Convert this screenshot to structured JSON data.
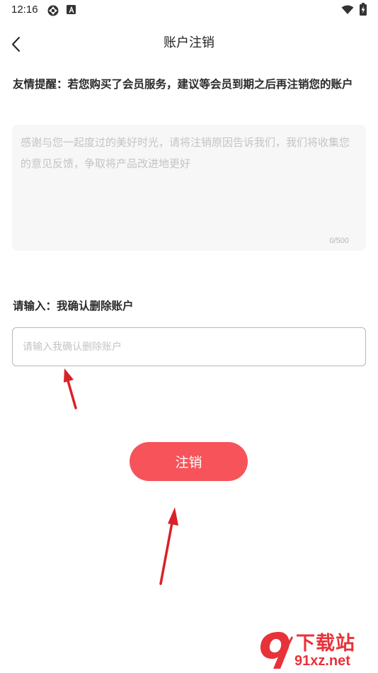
{
  "status_bar": {
    "time": "12:16",
    "icons": [
      "sync-icon",
      "a-badge-icon",
      "wifi-icon",
      "battery-charging-icon"
    ]
  },
  "header": {
    "title": "账户注销",
    "back_icon": "chevron-left-icon"
  },
  "notice": {
    "text": "友情提醒：若您购买了会员服务，建议等会员到期之后再注销您的账户"
  },
  "reason": {
    "placeholder": "感谢与您一起度过的美好时光，请将注销原因告诉我们，我们将收集您的意见反馈，争取将产品改进地更好",
    "value": "",
    "counter": "0/500"
  },
  "confirm": {
    "label": "请输入：我确认删除账户",
    "placeholder": "请输入我确认删除账户",
    "value": ""
  },
  "submit": {
    "label": "注销"
  },
  "colors": {
    "accent": "#f6535a",
    "annotation_arrow": "#d92128",
    "input_bg": "#f7f7f7",
    "placeholder": "#c4c4c4"
  },
  "watermark": {
    "line1": "下载站",
    "line2": "91xz.net",
    "logo_icon": "91-logo-icon"
  }
}
